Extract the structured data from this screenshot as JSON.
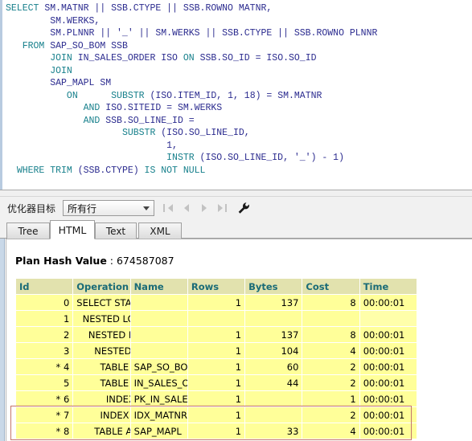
{
  "editor": {
    "name": "sql-editor",
    "lines": [
      [
        {
          "t": "SELECT",
          "c": "kw"
        },
        {
          "t": " SM.MATNR || SSB.CTYPE || SSB.ROWNO MATNR,",
          "c": "id"
        }
      ],
      [
        {
          "t": "        SM.WERKS,",
          "c": "id"
        }
      ],
      [
        {
          "t": "        SM.PLNNR || '_' || SM.WERKS || SSB.CTYPE || SSB.ROWNO PLNNR",
          "c": "id"
        }
      ],
      [
        {
          "t": "   ",
          "c": "id"
        },
        {
          "t": "FROM",
          "c": "kw"
        },
        {
          "t": " SAP_SO_BOM SSB",
          "c": "id"
        }
      ],
      [
        {
          "t": "        ",
          "c": "id"
        },
        {
          "t": "JOIN",
          "c": "kw"
        },
        {
          "t": " IN_SALES_ORDER ISO ",
          "c": "id"
        },
        {
          "t": "ON",
          "c": "kw"
        },
        {
          "t": " SSB.SO_ID = ISO.SO_ID",
          "c": "id"
        }
      ],
      [
        {
          "t": "        ",
          "c": "id"
        },
        {
          "t": "JOIN",
          "c": "kw"
        }
      ],
      [
        {
          "t": "        SAP_MAPL SM",
          "c": "id"
        }
      ],
      [
        {
          "t": "           ",
          "c": "id"
        },
        {
          "t": "ON",
          "c": "kw"
        },
        {
          "t": "      ",
          "c": "id"
        },
        {
          "t": "SUBSTR",
          "c": "kw"
        },
        {
          "t": " (ISO.ITEM_ID, 1, 18) = SM.MATNR",
          "c": "id"
        }
      ],
      [
        {
          "t": "              ",
          "c": "id"
        },
        {
          "t": "AND",
          "c": "kw"
        },
        {
          "t": " ISO.SITEID = SM.WERKS",
          "c": "id"
        }
      ],
      [
        {
          "t": "              ",
          "c": "id"
        },
        {
          "t": "AND",
          "c": "kw"
        },
        {
          "t": " SSB.SO_LINE_ID =",
          "c": "id"
        }
      ],
      [
        {
          "t": "                     ",
          "c": "id"
        },
        {
          "t": "SUBSTR",
          "c": "kw"
        },
        {
          "t": " (ISO.SO_LINE_ID,",
          "c": "id"
        }
      ],
      [
        {
          "t": "                             1,",
          "c": "id"
        }
      ],
      [
        {
          "t": "                             ",
          "c": "id"
        },
        {
          "t": "INSTR",
          "c": "kw"
        },
        {
          "t": " (ISO.SO_LINE_ID, '_') - 1)",
          "c": "id"
        }
      ],
      [
        {
          "t": "  ",
          "c": "id"
        },
        {
          "t": "WHERE TRIM",
          "c": "kw"
        },
        {
          "t": " (SSB.CTYPE) ",
          "c": "id"
        },
        {
          "t": "IS NOT NULL",
          "c": "kw"
        }
      ]
    ]
  },
  "toolbar": {
    "optimizer_label": "优化器目标",
    "optimizer_value": "所有行",
    "nav_first": "first-record",
    "nav_prev": "previous-record",
    "nav_next": "next-record",
    "nav_last": "last-record",
    "settings": "settings-wrench"
  },
  "tabs": [
    {
      "label": "Tree",
      "active": false
    },
    {
      "label": "HTML",
      "active": true
    },
    {
      "label": "Text",
      "active": false
    },
    {
      "label": "XML",
      "active": false
    }
  ],
  "plan": {
    "hash_label": "Plan Hash Value",
    "hash_sep": " : ",
    "hash_value": "674587087",
    "columns": [
      "Id",
      "Operation",
      "Name",
      "Rows",
      "Bytes",
      "Cost",
      "Time"
    ],
    "highlight_color": "#c4746b",
    "header_bg": "#e2e2ae",
    "row_bg": "#ffff99",
    "header_text": "#1a6b77",
    "rows": [
      {
        "id": "0",
        "indent": 0,
        "operation": "SELECT STATEMENT",
        "name": "",
        "rows": "1",
        "bytes": "137",
        "cost": "8",
        "time": "00:00:01",
        "highlighted": false
      },
      {
        "id": "1",
        "indent": 1,
        "operation": "NESTED LOOPS",
        "name": "",
        "rows": "",
        "bytes": "",
        "cost": "",
        "time": "",
        "highlighted": false
      },
      {
        "id": "2",
        "indent": 2,
        "operation": "NESTED LOOPS",
        "name": "",
        "rows": "1",
        "bytes": "137",
        "cost": "8",
        "time": "00:00:01",
        "highlighted": false
      },
      {
        "id": "3",
        "indent": 3,
        "operation": "NESTED LOOPS",
        "name": "",
        "rows": "1",
        "bytes": "104",
        "cost": "4",
        "time": "00:00:01",
        "highlighted": false
      },
      {
        "id": "* 4",
        "indent": 4,
        "operation": "TABLE ACCESS FULL",
        "name": "SAP_SO_BOM",
        "rows": "1",
        "bytes": "60",
        "cost": "2",
        "time": "00:00:01",
        "highlighted": false
      },
      {
        "id": "5",
        "indent": 4,
        "operation": "TABLE ACCESS BY INDEX ROWID",
        "name": "IN_SALES_ORDER",
        "rows": "1",
        "bytes": "44",
        "cost": "2",
        "time": "00:00:01",
        "highlighted": false
      },
      {
        "id": "* 6",
        "indent": 5,
        "operation": "INDEX RANGE SCAN",
        "name": "PK_IN_SALES_ORDER",
        "rows": "1",
        "bytes": "",
        "cost": "1",
        "time": "00:00:01",
        "highlighted": false
      },
      {
        "id": "* 7",
        "indent": 4,
        "operation": "INDEX RANGE SCAN",
        "name": "IDX_MATNR",
        "rows": "1",
        "bytes": "",
        "cost": "2",
        "time": "00:00:01",
        "highlighted": true
      },
      {
        "id": "* 8",
        "indent": 3,
        "operation": "TABLE ACCESS BY INDEX ROWID",
        "name": "SAP_MAPL",
        "rows": "1",
        "bytes": "33",
        "cost": "4",
        "time": "00:00:01",
        "highlighted": true
      }
    ]
  }
}
